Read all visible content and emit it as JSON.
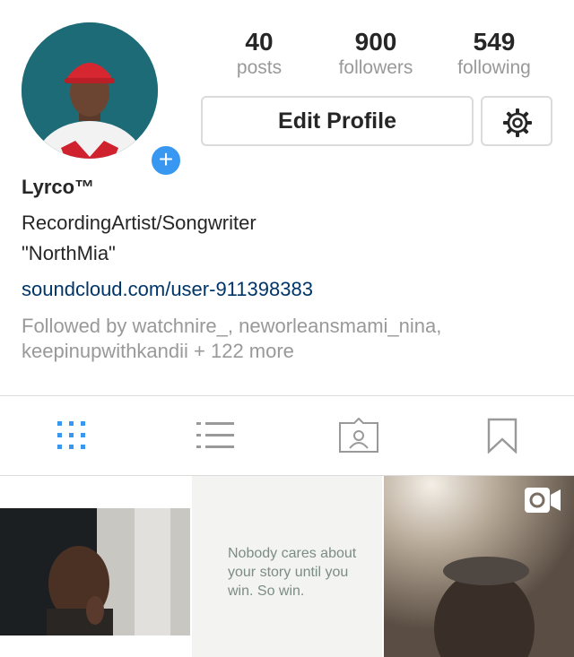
{
  "profile": {
    "stats": [
      {
        "value": "40",
        "label": "posts"
      },
      {
        "value": "900",
        "label": "followers"
      },
      {
        "value": "549",
        "label": "following"
      }
    ],
    "edit_label": "Edit Profile",
    "name": "Lyrco™",
    "bio_line1": "RecordingArtist/Songwriter",
    "bio_line2": "\"NorthMia\"",
    "link": "soundcloud.com/user-911398383",
    "followed_by": "Followed by watchnire_, neworleansmami_nina, keepinupwithkandii + 122 more"
  },
  "tabs": [
    {
      "icon": "grid-icon",
      "active": true
    },
    {
      "icon": "list-icon",
      "active": false
    },
    {
      "icon": "tagged-photos-icon",
      "active": false
    },
    {
      "icon": "bookmark-icon",
      "active": false
    }
  ],
  "grid": {
    "post2_text": "Nobody cares about your story until you win. So win."
  },
  "colors": {
    "accent": "#3897f0",
    "link": "#003569",
    "muted": "#999999",
    "border": "#dbdbdb"
  }
}
